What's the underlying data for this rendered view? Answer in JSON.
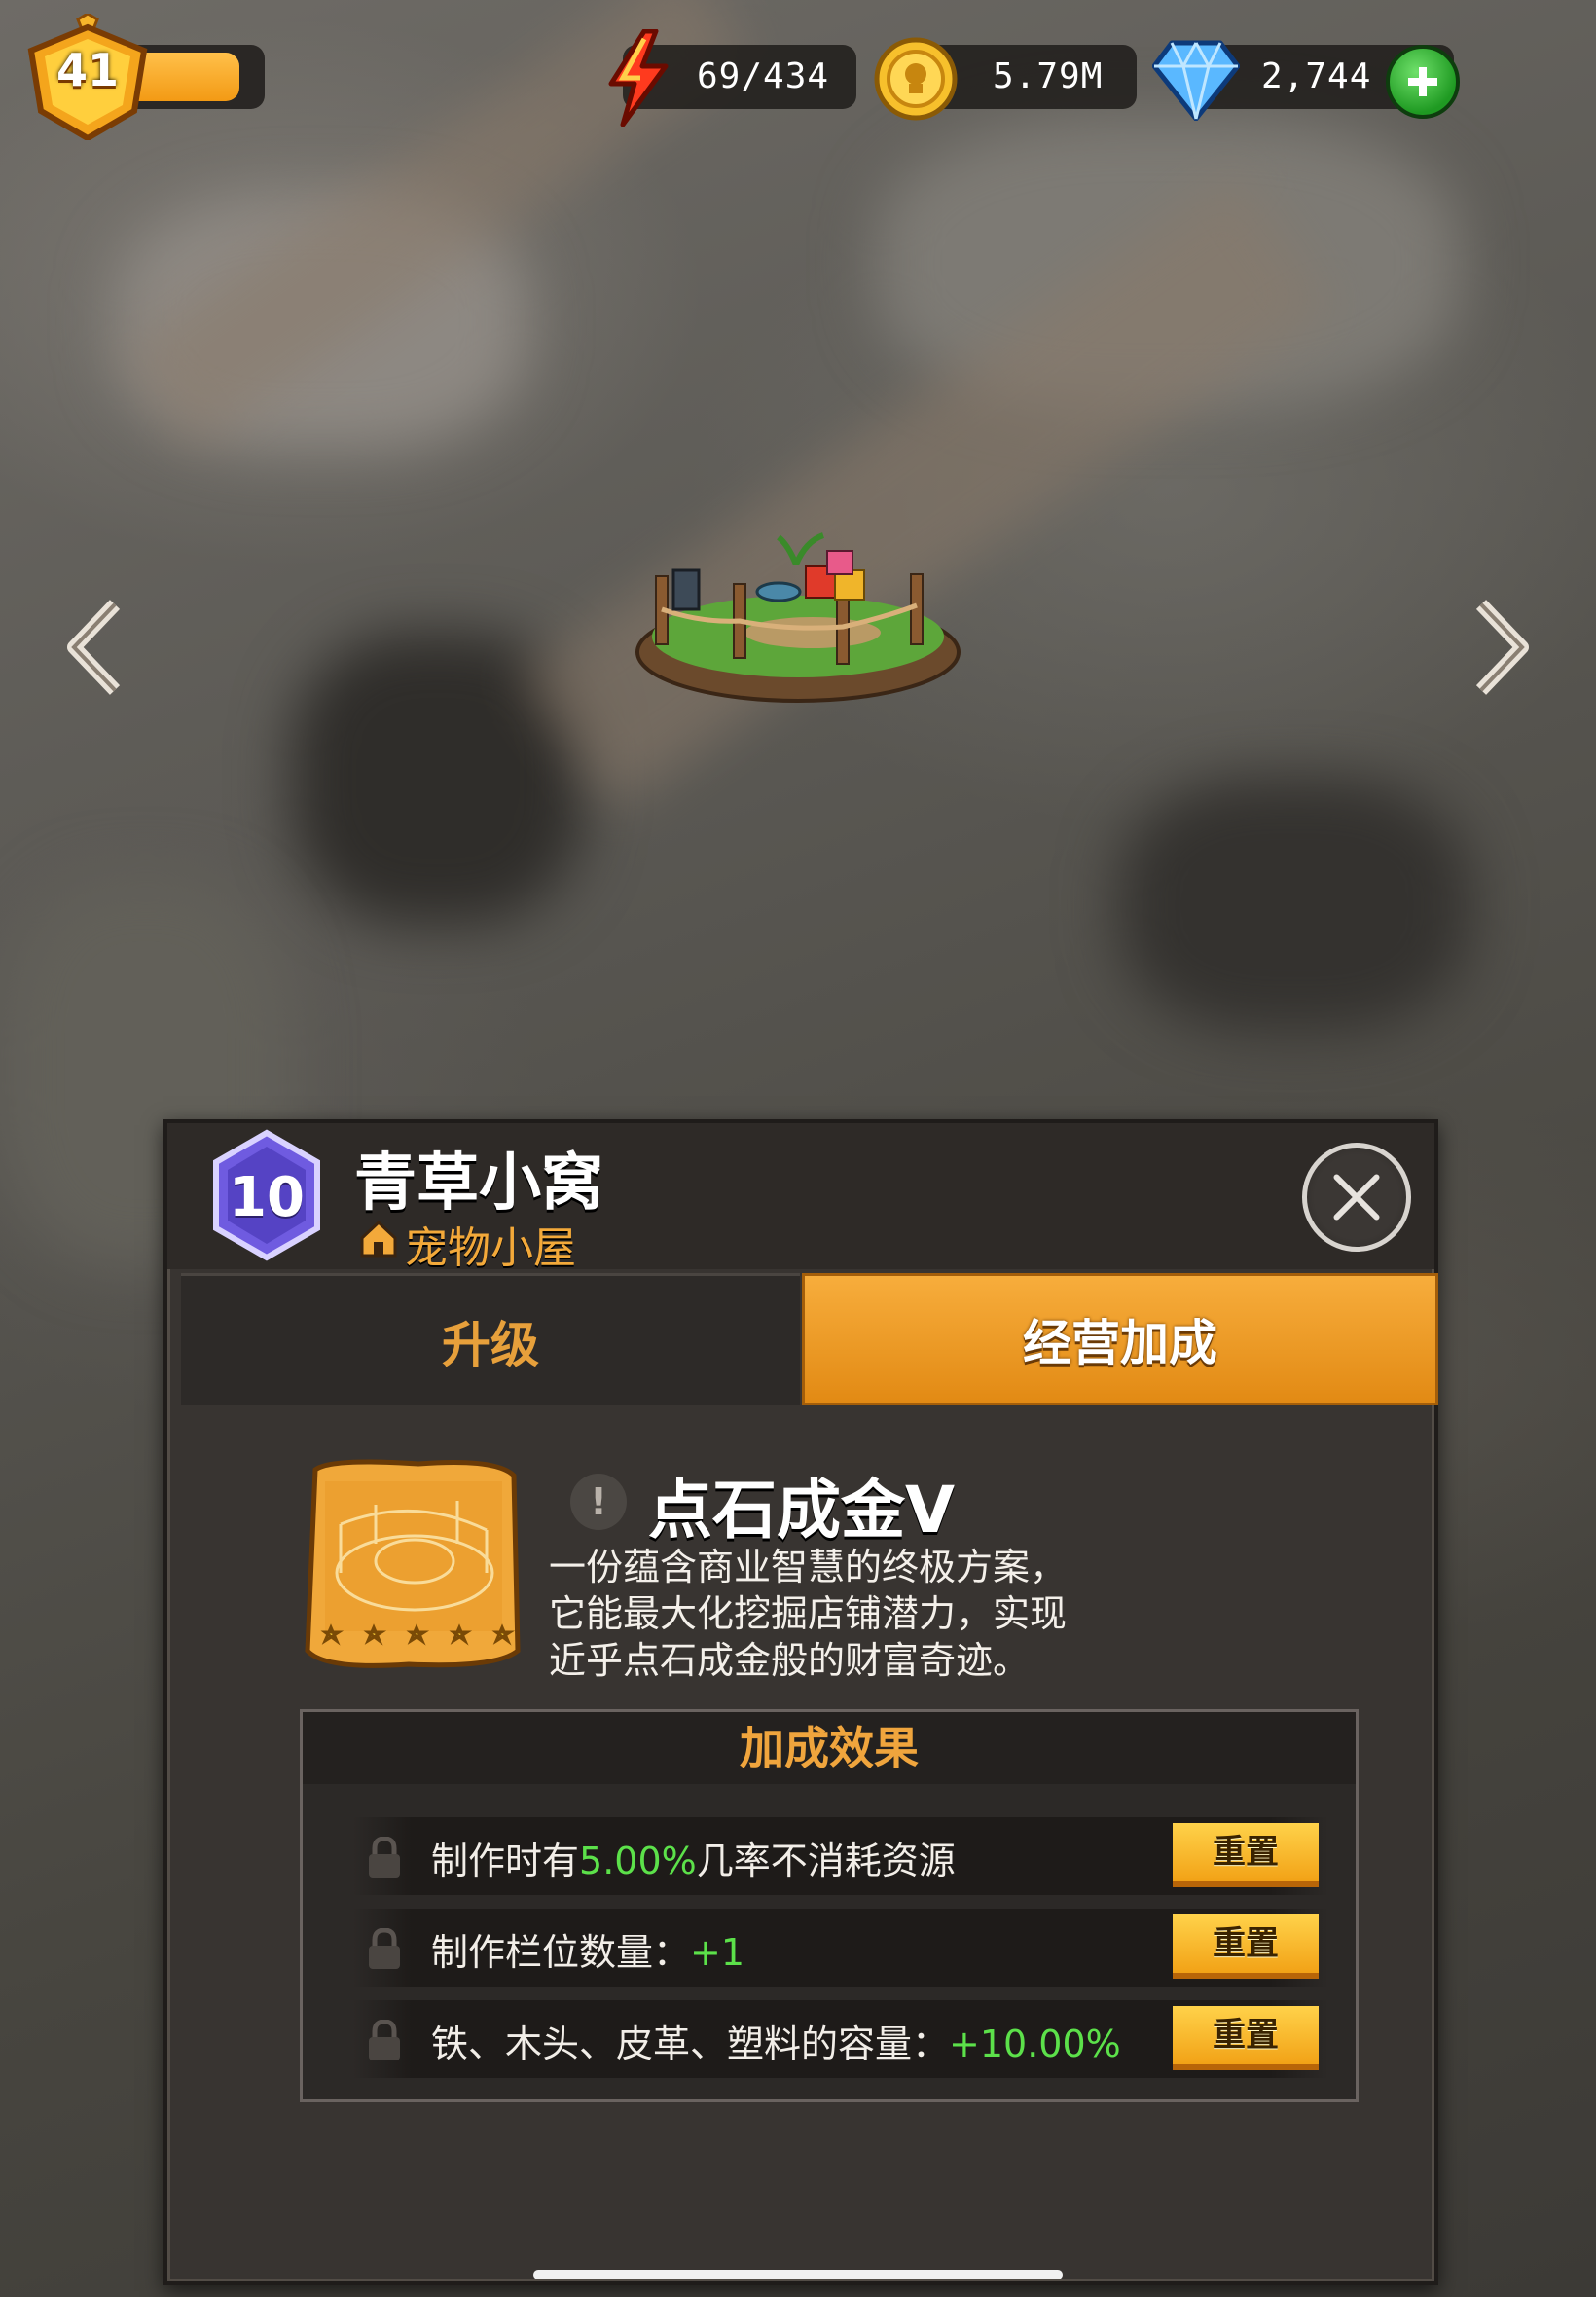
{
  "hud": {
    "player_level": "41",
    "xp_progress_pct": 80,
    "energy": "69/434",
    "gold": "5.79M",
    "gems": "2,744"
  },
  "building": {
    "level": "10",
    "name": "青草小窝",
    "type": "宠物小屋"
  },
  "tabs": {
    "upgrade": "升级",
    "bonus": "经营加成",
    "active": "bonus"
  },
  "skill": {
    "name": "点石成金Ⅴ",
    "info_glyph": "!",
    "description": "一份蕴含商业智慧的终极方案，它能最大化挖掘店铺潜力，实现近乎点石成金般的财富奇迹。",
    "stars": 5
  },
  "bonus_effects": {
    "title": "加成效果",
    "rows": [
      {
        "prefix": "制作时有",
        "value": "5.00%",
        "suffix": "几率不消耗资源",
        "reset_label": "重置"
      },
      {
        "prefix": "制作栏位数量：",
        "value": "+1",
        "suffix": "",
        "reset_label": "重置"
      },
      {
        "prefix": "铁、木头、皮革、塑料的容量：",
        "value": "+10.00%",
        "suffix": "",
        "reset_label": "重置"
      }
    ]
  },
  "icons": {
    "energy": "lightning-icon",
    "gold": "coin-icon",
    "gems": "diamond-icon",
    "add": "plus-icon",
    "prev": "chevron-left-icon",
    "next": "chevron-right-icon",
    "close": "close-icon",
    "lock": "lock-icon",
    "house": "house-icon"
  },
  "colors": {
    "accent_orange": "#f0a53d",
    "value_green": "#5ce14a",
    "level_hex_purple": "#6f5be0"
  }
}
